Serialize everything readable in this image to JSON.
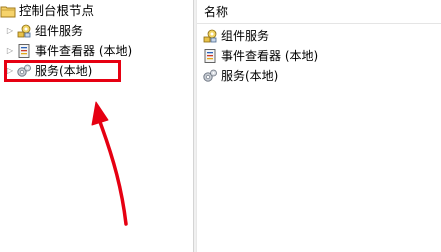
{
  "tree": {
    "root_label": "控制台根节点",
    "items": [
      {
        "label": "组件服务",
        "icon": "component-services-icon"
      },
      {
        "label": "事件查看器 (本地)",
        "icon": "event-viewer-icon"
      },
      {
        "label": "服务(本地)",
        "icon": "services-gear-icon"
      }
    ]
  },
  "list": {
    "column_header": "名称",
    "rows": [
      {
        "label": "组件服务",
        "icon": "component-services-icon"
      },
      {
        "label": "事件查看器 (本地)",
        "icon": "event-viewer-icon"
      },
      {
        "label": "服务(本地)",
        "icon": "services-gear-icon"
      }
    ]
  },
  "annotation": {
    "highlight_color": "#e60012",
    "arrow_color": "#e60012"
  }
}
